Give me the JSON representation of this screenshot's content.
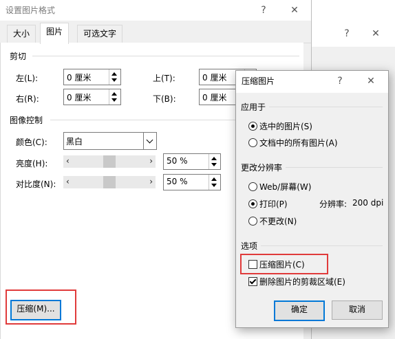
{
  "back_dialog": {
    "help": "?",
    "close": "✕"
  },
  "main_dialog": {
    "title": "设置图片格式",
    "help": "?",
    "close": "✕",
    "tabs": [
      "大小",
      "图片",
      "可选文字"
    ],
    "crop": {
      "section": "剪切",
      "left_label": "左(L):",
      "left_value": "0 厘米",
      "top_label": "上(T):",
      "top_value": "0 厘米",
      "right_label": "右(R):",
      "right_value": "0 厘米",
      "bottom_label": "下(B):",
      "bottom_value": "0 厘米"
    },
    "image_control": {
      "section": "图像控制",
      "color_label": "颜色(C):",
      "color_value": "黑白",
      "brightness_label": "亮度(H):",
      "brightness_value": "50 %",
      "contrast_label": "对比度(N):",
      "contrast_value": "50 %",
      "brightness_level": 0.5,
      "contrast_level": 0.5
    },
    "compress_button": "压缩(M)..."
  },
  "compress_dialog": {
    "title": "压缩图片",
    "help": "?",
    "close": "✕",
    "apply_to": {
      "section": "应用于",
      "selected": "选中的图片(S)",
      "all": "文档中的所有图片(A)"
    },
    "resolution": {
      "section": "更改分辨率",
      "web": "Web/屏幕(W)",
      "print": "打印(P)",
      "dpi_label": "分辨率:",
      "dpi_value": "200 dpi",
      "no_change": "不更改(N)"
    },
    "options": {
      "section": "选项",
      "compress": "压缩图片(C)",
      "delete_crop": "删除图片的剪裁区域(E)"
    },
    "ok": "确定",
    "cancel": "取消"
  },
  "colors": {
    "highlight": "#e03a3a",
    "focus": "#0078d7"
  }
}
